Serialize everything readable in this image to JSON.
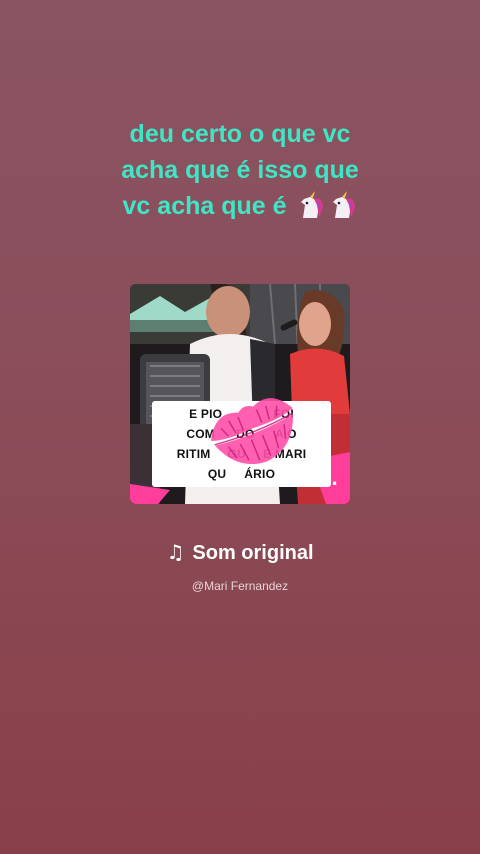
{
  "story_text": {
    "line1": "deu certo o que vc",
    "line2": "acha que é isso que",
    "line3": "vc acha que é",
    "emojis": [
      "unicorn-icon",
      "unicorn-icon"
    ]
  },
  "music_card": {
    "caption_lines": [
      "E PIO",
      "FOI",
      "COM",
      "DO",
      "A O",
      "RITIM",
      "GU",
      "E MARI",
      "QU",
      "ÁRIO"
    ],
    "logo": "ll."
  },
  "music": {
    "note_icon": "music-note-icon",
    "note_glyph": "♫",
    "title": "Som original",
    "artist": "@Mari Fernandez"
  },
  "colors": {
    "story_text": "#3fe6c6",
    "background_top": "#8a5462",
    "background_bottom": "#893f48",
    "accent_pink": "#ff3d9a"
  }
}
